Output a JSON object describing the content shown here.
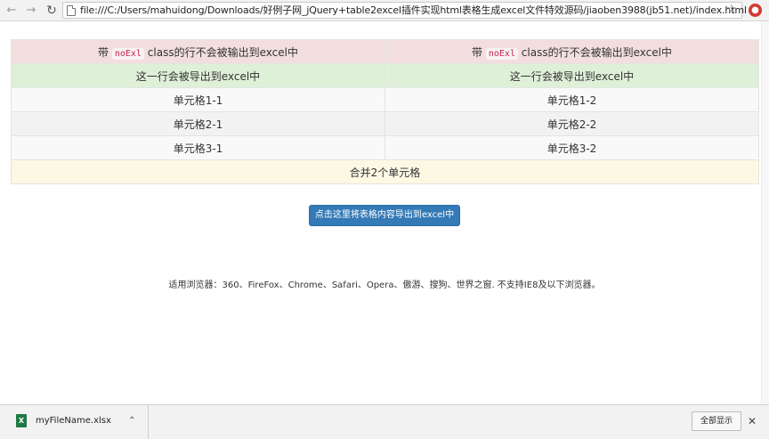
{
  "browser": {
    "url": "file:///C:/Users/mahuidong/Downloads/好例子网_jQuery+table2excel插件实现html表格生成excel文件特效源码/jiaoben3988(jb51.net)/index.html"
  },
  "table": {
    "noexport_row": {
      "prefix": "带 ",
      "code": "noExl",
      "suffix": " class的行不会被输出到excel中"
    },
    "export_row": [
      "这一行会被导出到excel中",
      "这一行会被导出到excel中"
    ],
    "data_rows": [
      [
        "单元格1-1",
        "单元格1-2"
      ],
      [
        "单元格2-1",
        "单元格2-2"
      ],
      [
        "单元格3-1",
        "单元格3-2"
      ]
    ],
    "merged_row": "合并2个单元格"
  },
  "export_button": "点击这里将表格内容导出到excel中",
  "browser_note": "适用浏览器：360、FireFox、Chrome、Safari、Opera、傲游、搜狗、世界之窗. 不支持IE8及以下浏览器。",
  "download": {
    "file_name": "myFileName.xlsx",
    "show_all": "全部显示"
  }
}
